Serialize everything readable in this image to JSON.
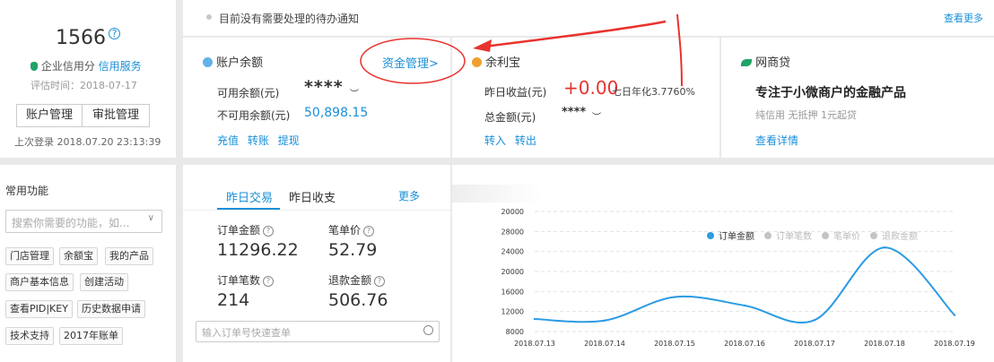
{
  "profile": {
    "score": "1566",
    "credit_label": "企业信用分",
    "credit_link": "信用服务",
    "eval_time": "评估时间：2018-07-17",
    "btn_account": "账户管理",
    "btn_approval": "审批管理",
    "last_login": "上次登录 2018.07.20 23:13:39"
  },
  "notice": {
    "text": "目前没有需要处理的待办通知",
    "view_more": "查看更多"
  },
  "balance": {
    "title": "账户余额",
    "manage_link": "资金管理>",
    "available_label": "可用余额(元)",
    "available_value": "****",
    "unavailable_label": "不可用余额(元)",
    "unavailable_value": "50,898.15",
    "actions": [
      "充值",
      "转账",
      "提现"
    ]
  },
  "yuebao": {
    "title": "余利宝",
    "yesterday_label": "昨日收益(元)",
    "yesterday_value": "+0.00",
    "annual": "七日年化3.7760%",
    "total_label": "总金额(元)",
    "total_value": "****",
    "actions": [
      "转入",
      "转出"
    ]
  },
  "loan": {
    "title": "网商贷",
    "headline": "专注于小微商户的金融产品",
    "sub": "纯信用 无抵押 1元起贷",
    "link": "查看详情"
  },
  "functions": {
    "title": "常用功能",
    "search_placeholder": "搜索你需要的功能，如...",
    "tags": [
      "门店管理",
      "余额宝",
      "我的产品",
      "商户基本信息",
      "创建活动",
      "查看PID|KEY",
      "历史数据申请",
      "技术支持",
      "2017年账单"
    ]
  },
  "trade": {
    "tabs": [
      "昨日交易",
      "昨日收支"
    ],
    "more": "更多",
    "order_amount_label": "订单金额",
    "order_amount": "11296.22",
    "unit_price_label": "笔单价",
    "unit_price": "52.79",
    "order_count_label": "订单笔数",
    "order_count": "214",
    "refund_label": "退款金额",
    "refund": "506.76",
    "search_placeholder": "输入订单号快速查单"
  },
  "colors": {
    "accent": "#1a8fd8",
    "red": "#e8332e",
    "line": "#2b9be3"
  },
  "chart_data": {
    "type": "line",
    "categories": [
      "2018.07.13",
      "2018.07.14",
      "2018.07.15",
      "2018.07.16",
      "2018.07.17",
      "2018.07.18",
      "2018.07.19"
    ],
    "y_ticks": [
      "8000",
      "12000",
      "16000",
      "20000",
      "24000",
      "28000",
      "20000"
    ],
    "series": [
      {
        "name": "订单金额",
        "values": [
          10500,
          10200,
          14900,
          13200,
          10300,
          24800,
          11300
        ],
        "active": true
      },
      {
        "name": "订单笔数",
        "active": false
      },
      {
        "name": "笔单价",
        "active": false
      },
      {
        "name": "退款金额",
        "active": false
      }
    ],
    "ylim": [
      8000,
      32000
    ],
    "grid": true,
    "legend": "top-right"
  }
}
